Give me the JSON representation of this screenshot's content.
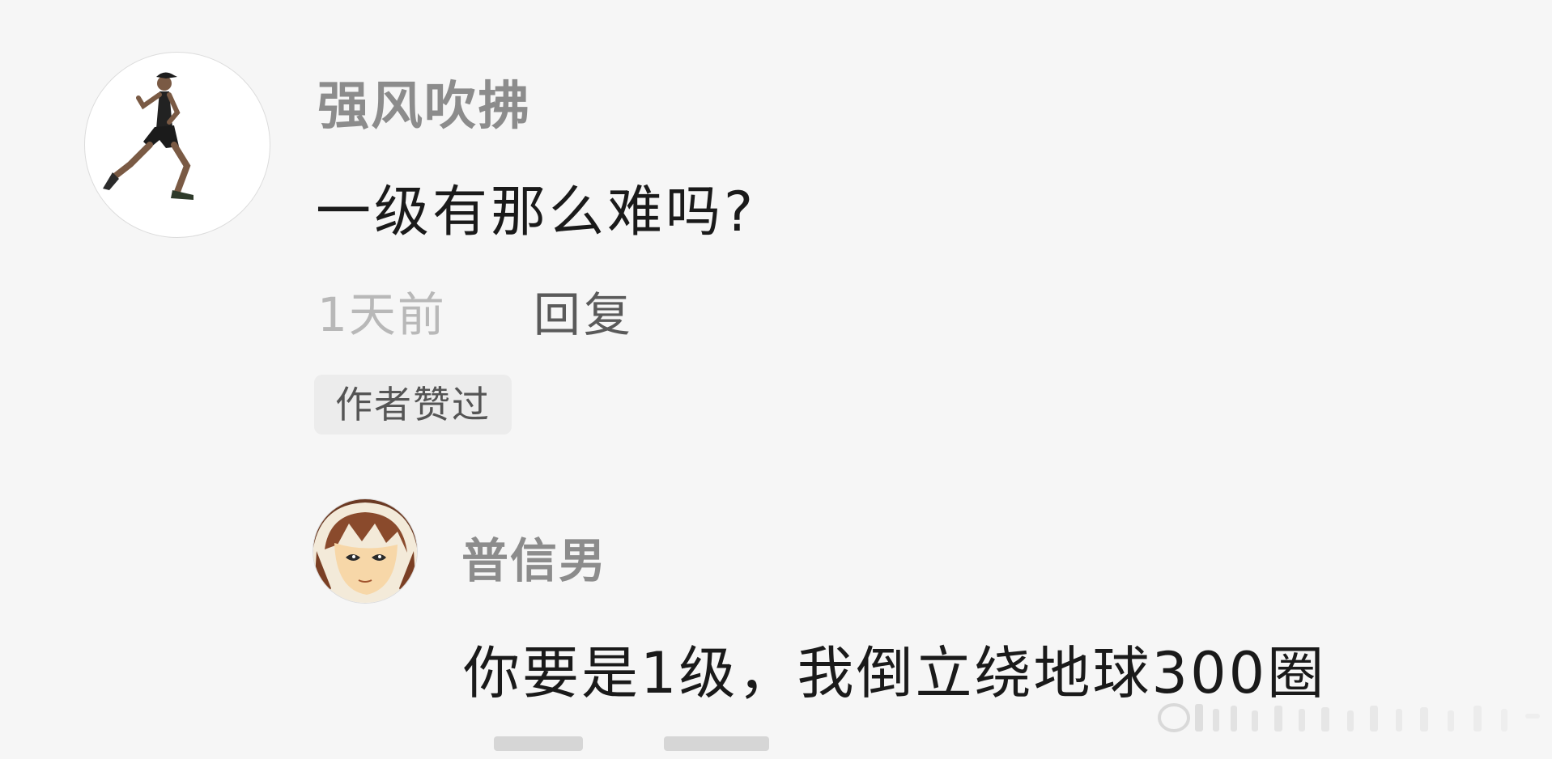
{
  "comment": {
    "username": "强风吹拂",
    "text": "一级有那么难吗?",
    "time": "1天前",
    "reply_label": "回复",
    "badge": "作者赞过"
  },
  "reply": {
    "username": "普信男",
    "text": "你要是1级，我倒立绕地球300圈"
  },
  "icons": {
    "main_avatar": "runner-avatar",
    "reply_avatar": "anime-face-avatar"
  },
  "colors": {
    "username": "#8c8c8c",
    "text": "#1a1a1a",
    "time": "#b8b8b8",
    "badge_bg": "#ececec"
  }
}
